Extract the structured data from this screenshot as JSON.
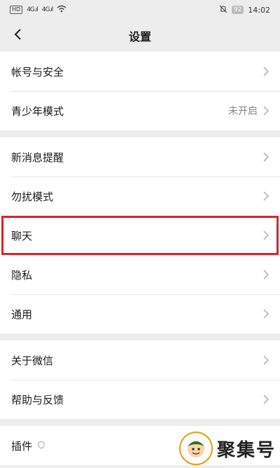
{
  "status_bar": {
    "hd_badge": "HD",
    "signal_1": "4G.ıl",
    "signal_2": "4G.ıl",
    "battery": "92",
    "time": "14:02"
  },
  "nav": {
    "title": "设置"
  },
  "groups": [
    {
      "items": [
        {
          "label": "帐号与安全",
          "value": ""
        },
        {
          "label": "青少年模式",
          "value": "未开启"
        }
      ]
    },
    {
      "items": [
        {
          "label": "新消息提醒",
          "value": ""
        },
        {
          "label": "勿扰模式",
          "value": ""
        },
        {
          "label": "聊天",
          "value": ""
        },
        {
          "label": "隐私",
          "value": ""
        },
        {
          "label": "通用",
          "value": ""
        }
      ]
    },
    {
      "items": [
        {
          "label": "关于微信",
          "value": ""
        },
        {
          "label": "帮助与反馈",
          "value": ""
        }
      ]
    },
    {
      "items": [
        {
          "label": "插件",
          "value": ""
        }
      ]
    }
  ],
  "watermark": {
    "text": "聚集号"
  },
  "colors": {
    "highlight": "#d9252b",
    "background": "#ededed"
  }
}
